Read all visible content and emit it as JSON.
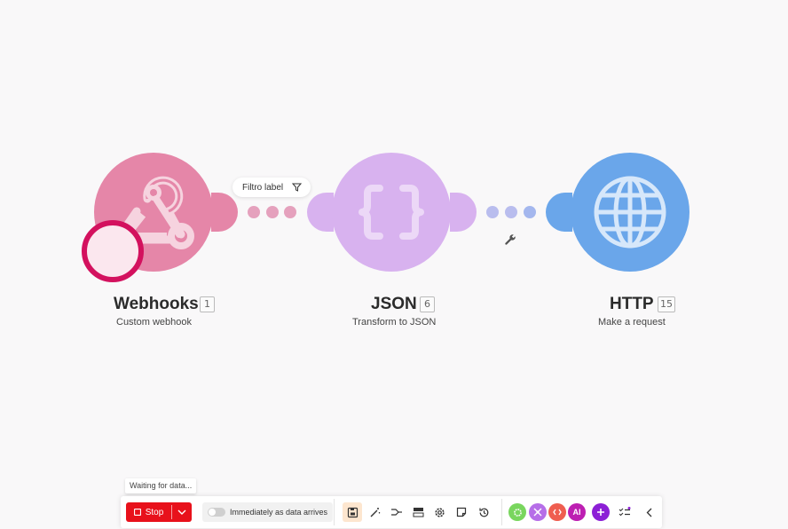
{
  "scenario": {
    "modules": [
      {
        "title": "Webhooks",
        "id": "1",
        "subtitle": "Custom webhook",
        "color": "#e586a8"
      },
      {
        "title": "JSON",
        "id": "6",
        "subtitle": "Transform to JSON",
        "color": "#d8b2ef"
      },
      {
        "title": "HTTP",
        "id": "15",
        "subtitle": "Make a request",
        "color": "#6aa6ea"
      }
    ],
    "filter": {
      "label": "Filtro label"
    }
  },
  "toolbar": {
    "tooltip": "Waiting for data...",
    "stop_label": "Stop",
    "toggle_label": "Immediately as data arrives",
    "ai_label": "AI"
  },
  "colors": {
    "stop": "#e8111b",
    "accent_ring": "#d3115e",
    "green": "#79d65e",
    "purple": "#b66ee8",
    "orange": "#ef5e50",
    "magenta": "#bd1fb2",
    "violet": "#8c1fd6"
  }
}
